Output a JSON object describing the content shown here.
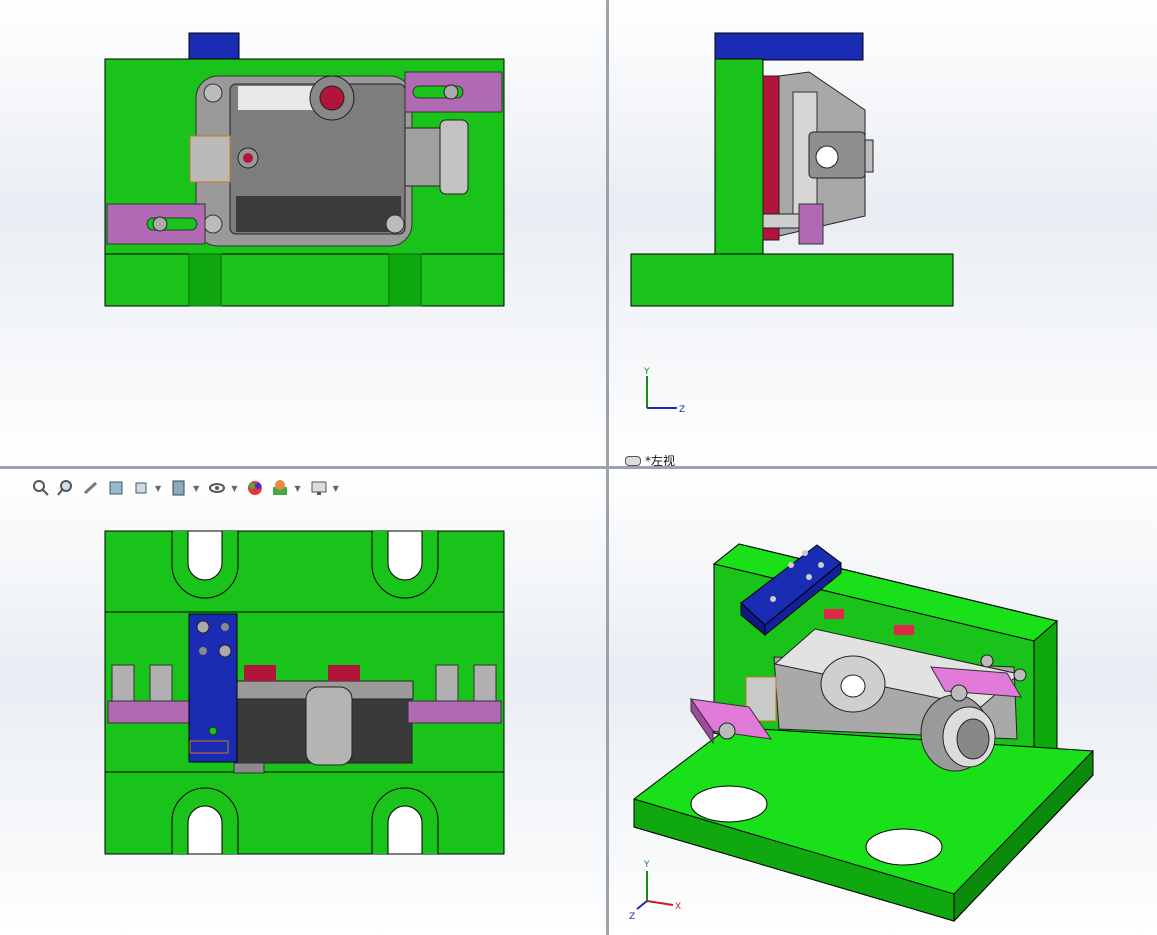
{
  "viewports": {
    "top_left": {
      "name": "front"
    },
    "top_right": {
      "name": "left",
      "label": "*左视"
    },
    "bottom_left": {
      "name": "top"
    },
    "bottom_right": {
      "name": "isometric"
    }
  },
  "triad": {
    "x": "X",
    "y": "Y",
    "z": "Z"
  },
  "toolbar": {
    "icons": [
      "zoom-to-fit-icon",
      "zoom-to-area-icon",
      "previous-view-icon",
      "section-view-icon",
      "view-orientation-icon",
      "display-style-icon",
      "hide-show-icon",
      "edit-appearance-icon",
      "apply-scene-icon",
      "view-settings-icon"
    ]
  },
  "colors": {
    "base": "#19c319",
    "base_dark": "#0e8f0e",
    "clamp": "#1a2bb4",
    "arm": "#b06ab4",
    "part": "#8d8d8d",
    "part_dark": "#4a4a4a",
    "red": "#b3143a"
  }
}
